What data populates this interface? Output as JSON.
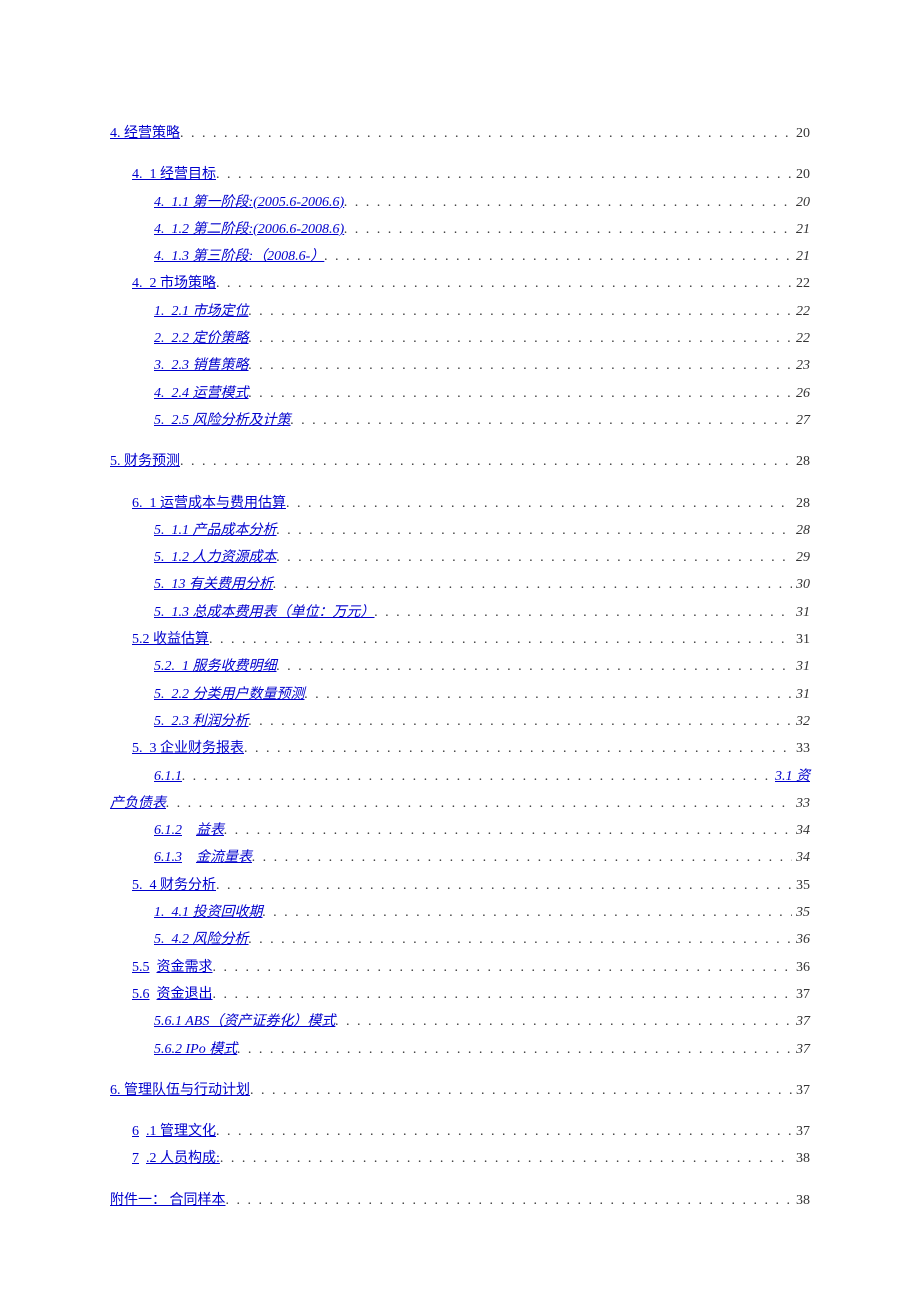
{
  "entries": [
    {
      "type": "row",
      "level": 0,
      "italic": false,
      "link": true,
      "prefix": "4.",
      "text": "经营策略",
      "plain_after": "",
      "page": "20",
      "gap": false
    },
    {
      "type": "row",
      "level": 1,
      "italic": false,
      "link": true,
      "prefix": "4.  1",
      "text": "经营目标",
      "page": "20",
      "gap": true
    },
    {
      "type": "row",
      "level": 2,
      "italic": true,
      "link": true,
      "prefix": "4.  1.1",
      "text": "第一阶段:(2005.6-2006.6)",
      "page": "20",
      "gap": false
    },
    {
      "type": "row",
      "level": 2,
      "italic": true,
      "link": true,
      "prefix": "4.  1.2",
      "text": "第二阶段:(2006.6-2008.6)",
      "page": "21",
      "gap": false
    },
    {
      "type": "row",
      "level": 2,
      "italic": true,
      "link": true,
      "prefix": "4.  1.3",
      "text": "第三阶段:（2008.6-）",
      "page": "21",
      "gap": false
    },
    {
      "type": "row",
      "level": 1,
      "italic": false,
      "link": true,
      "prefix": "4.  2",
      "text": "市场策略",
      "page": "22",
      "gap": false
    },
    {
      "type": "row",
      "level": 2,
      "italic": true,
      "link": true,
      "prefix": "1.  2.1",
      "text": "市场定位",
      "page": "22",
      "gap": false
    },
    {
      "type": "row",
      "level": 2,
      "italic": true,
      "link": true,
      "prefix": "2.  2.2",
      "text": "定价策略",
      "page": "22",
      "gap": false
    },
    {
      "type": "row",
      "level": 2,
      "italic": true,
      "link": true,
      "prefix": "3.  2.3",
      "text": "销售策略",
      "page": "23",
      "gap": false
    },
    {
      "type": "row",
      "level": 2,
      "italic": true,
      "link": true,
      "prefix": "4.  2.4",
      "text": "运营模式",
      "page": "26",
      "gap": false
    },
    {
      "type": "row",
      "level": 2,
      "italic": true,
      "link": true,
      "prefix": "5.  2.5",
      "text": "风险分析及计策",
      "page": "27",
      "gap": false
    },
    {
      "type": "row",
      "level": 0,
      "italic": false,
      "link": true,
      "prefix": "5.",
      "text": "财务预测",
      "page": "28",
      "gap": true
    },
    {
      "type": "row",
      "level": 1,
      "italic": false,
      "link": true,
      "prefix": "6.  1",
      "text": "运营成本与费用估算",
      "page": "28",
      "gap": true
    },
    {
      "type": "row",
      "level": 2,
      "italic": true,
      "link": true,
      "prefix": "5.  1.1",
      "text": "产品成本分析",
      "page": "28",
      "gap": false
    },
    {
      "type": "row",
      "level": 2,
      "italic": true,
      "link": true,
      "prefix": "5.  1.2",
      "text": "人力资源成本",
      "page": "29",
      "gap": false
    },
    {
      "type": "row",
      "level": 2,
      "italic": true,
      "link": true,
      "prefix": "5.  13",
      "text": "有关费用分析",
      "page": "30",
      "gap": false
    },
    {
      "type": "row",
      "level": 2,
      "italic": true,
      "link": true,
      "prefix": "5.  1.3",
      "text": "总成本费用表（单位：万元）",
      "page": "31",
      "gap": false
    },
    {
      "type": "row",
      "level": 1,
      "italic": false,
      "link": true,
      "prefix": "5.2",
      "text": "收益估算",
      "page": "31",
      "gap": false
    },
    {
      "type": "row",
      "level": 2,
      "italic": true,
      "link": true,
      "prefix": "5.2.  1",
      "text": "服务收费明细",
      "page": "31",
      "gap": false
    },
    {
      "type": "row",
      "level": 2,
      "italic": true,
      "link": true,
      "prefix": "5.  2.2",
      "text": "分类用户数量预测",
      "page": "31",
      "gap": false
    },
    {
      "type": "row",
      "level": 2,
      "italic": true,
      "link": true,
      "prefix": "5.  2.3",
      "text": "利润分析",
      "page": "32",
      "gap": false
    },
    {
      "type": "row",
      "level": 1,
      "italic": false,
      "link": true,
      "prefix": "5.  3",
      "text": "企业财务报表",
      "page": "33",
      "gap": false
    },
    {
      "type": "wrap",
      "indent": 44,
      "prefix": "6.1.1",
      "tail": "3.1 资产负债表",
      "page": "33",
      "gap": false
    },
    {
      "type": "row",
      "level": 2,
      "italic": true,
      "link": true,
      "prefix": "6.1.2",
      "gap_text": "    ",
      "text": "益表",
      "page": "34",
      "gap": false
    },
    {
      "type": "row",
      "level": 2,
      "italic": true,
      "link": true,
      "prefix": "6.1.3",
      "gap_text": "    ",
      "text": "金流量表",
      "page": "34",
      "gap": false
    },
    {
      "type": "row",
      "level": 1,
      "italic": false,
      "link": true,
      "prefix": "5.  4",
      "text": "财务分析",
      "page": "35",
      "gap": false
    },
    {
      "type": "row",
      "level": 2,
      "italic": true,
      "link": true,
      "prefix": "1.  4.1",
      "text": "投资回收期",
      "page": "35",
      "gap": false
    },
    {
      "type": "row",
      "level": 2,
      "italic": true,
      "link": true,
      "prefix": "5.  4.2",
      "text": "风险分析",
      "page": "36",
      "gap": false
    },
    {
      "type": "row",
      "level": 1,
      "italic": false,
      "link": true,
      "prefix": "5.5",
      "gap_text": "  ",
      "text": "资金需求",
      "page": "36",
      "gap": false
    },
    {
      "type": "row",
      "level": 1,
      "italic": false,
      "link": true,
      "prefix": "5.6",
      "gap_text": "  ",
      "text": "资金退出",
      "page": "37",
      "gap": false
    },
    {
      "type": "row",
      "level": 2,
      "italic": true,
      "link": true,
      "prefix": "5.6.1",
      "text": "ABS（资产证券化）模式",
      "page": "37",
      "gap": false
    },
    {
      "type": "row",
      "level": 2,
      "italic": true,
      "link": true,
      "prefix": "5.6.2",
      "text": "IPo 模式",
      "page": "37",
      "gap": false
    },
    {
      "type": "row",
      "level": 0,
      "italic": false,
      "link": true,
      "prefix": "6.",
      "text": "管理队伍与行动计划",
      "page": "37",
      "gap": true
    },
    {
      "type": "row",
      "level": 1,
      "italic": false,
      "link": true,
      "prefix": "6",
      "gap_text": "  ",
      "text": ".1 管理文化",
      "page": "37",
      "gap": true
    },
    {
      "type": "row",
      "level": 1,
      "italic": false,
      "link": true,
      "prefix": "7",
      "gap_text": "  ",
      "text": ".2 人员构成:",
      "page": "38",
      "gap": false
    },
    {
      "type": "row",
      "level": 0,
      "italic": false,
      "link": true,
      "prefix": "附件一：",
      "text": "合同样本",
      "page": "38",
      "gap": true
    }
  ]
}
